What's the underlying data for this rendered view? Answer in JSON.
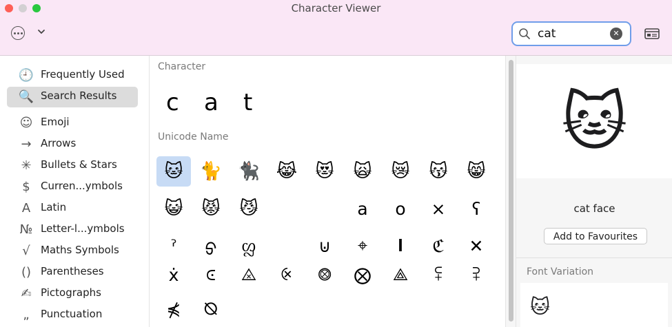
{
  "window": {
    "title": "Character Viewer"
  },
  "toolbar": {
    "search_value": "cat",
    "clear_icon": "x-mark",
    "colors": {
      "titlebar_bg": "#fae7f6",
      "search_focus": "#6f9de9",
      "selection": "#c7dbf5"
    }
  },
  "sidebar": {
    "items": [
      {
        "label": "Frequently Used",
        "icon": "🕘",
        "selected": false
      },
      {
        "label": "Search Results",
        "icon": "🔍",
        "selected": true
      },
      {
        "label": "Emoji",
        "icon": "☺",
        "selected": false
      },
      {
        "label": "Arrows",
        "icon": "→",
        "selected": false
      },
      {
        "label": "Bullets & Stars",
        "icon": "✳",
        "selected": false
      },
      {
        "label": "Curren...ymbols",
        "icon": "$",
        "selected": false
      },
      {
        "label": "Latin",
        "icon": "A",
        "selected": false
      },
      {
        "label": "Letter-l...ymbols",
        "icon": "№",
        "selected": false
      },
      {
        "label": "Maths Symbols",
        "icon": "√",
        "selected": false
      },
      {
        "label": "Parentheses",
        "icon": "()",
        "selected": false
      },
      {
        "label": "Pictographs",
        "icon": "✍",
        "selected": false
      },
      {
        "label": "Punctuation",
        "icon": "„",
        "selected": false
      }
    ]
  },
  "main": {
    "character_heading": "Character",
    "characters": [
      "c",
      "a",
      "t"
    ],
    "unicode_heading": "Unicode Name",
    "rows": [
      [
        "🐱",
        "🐈",
        "🐈‍⬛",
        "😹",
        "😻",
        "🙀",
        "😿",
        "😽",
        "😸"
      ],
      [
        "😺",
        "😾",
        "😼",
        "",
        "",
        "a",
        "o",
        "×",
        "ʕ"
      ],
      [
        "ˀ",
        "ᢒ",
        "ᦜ",
        "",
        "⊍",
        "⌖",
        "𝐈",
        "ℭ",
        "✕"
      ],
      [
        "ẋ",
        "⪽",
        "⨻",
        "⨴",
        "⨷",
        "⨂",
        "⟁",
        "⪿",
        "⫀"
      ],
      [
        "⋠",
        "⦰"
      ]
    ]
  },
  "inspector": {
    "preview_char": "🐱",
    "char_name": "cat face",
    "favourites_label": "Add to Favourites",
    "font_variation_heading": "Font Variation",
    "variations": [
      "🐱"
    ]
  }
}
